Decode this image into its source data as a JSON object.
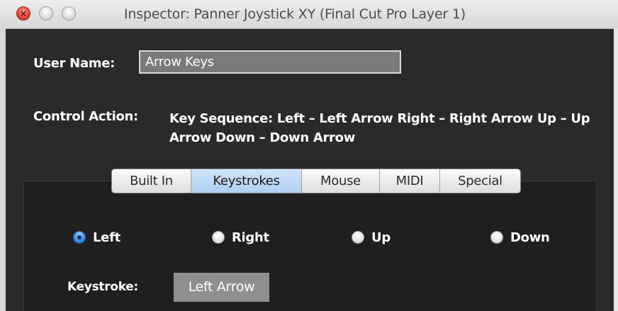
{
  "window": {
    "title": "Inspector: Panner Joystick XY (Final Cut Pro Layer 1)"
  },
  "form": {
    "user_name_label": "User Name:",
    "user_name_value": "Arrow Keys",
    "control_action_label": "Control Action:",
    "control_action_value": "Key Sequence:  Left – Left Arrow  Right – Right Arrow  Up – Up Arrow  Down – Down Arrow"
  },
  "tabs": [
    {
      "label": "Built In",
      "selected": false
    },
    {
      "label": "Keystrokes",
      "selected": true
    },
    {
      "label": "Mouse",
      "selected": false
    },
    {
      "label": "MIDI",
      "selected": false
    },
    {
      "label": "Special",
      "selected": false
    }
  ],
  "radios": [
    {
      "label": "Left",
      "checked": true
    },
    {
      "label": "Right",
      "checked": false
    },
    {
      "label": "Up",
      "checked": false
    },
    {
      "label": "Down",
      "checked": false
    }
  ],
  "keystroke": {
    "label": "Keystroke:",
    "value": "Left Arrow"
  },
  "colors": {
    "window_bg": "#2a2a2a",
    "selected_tab": "#b9d4f3",
    "radio_checked": "#3d8ee8",
    "close_button": "#e2463d"
  }
}
